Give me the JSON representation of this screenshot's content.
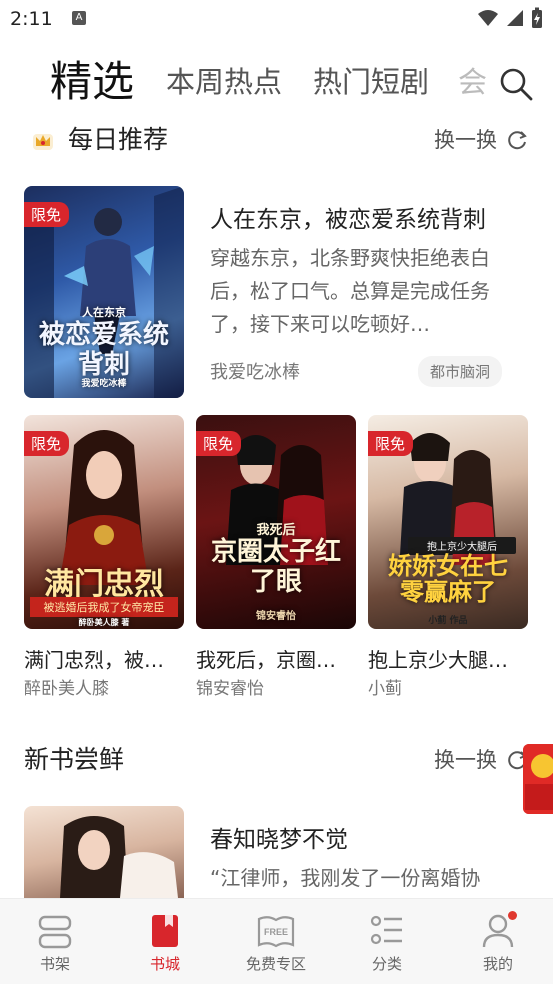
{
  "status": {
    "time": "2:11",
    "notif_glyph": "A"
  },
  "tabs": [
    {
      "label": "精选",
      "active": true
    },
    {
      "label": "本周热点",
      "active": false
    },
    {
      "label": "热门短剧",
      "active": false
    },
    {
      "label": "会",
      "active": false
    }
  ],
  "daily": {
    "title": "每日推荐",
    "refresh_label": "换一换",
    "featured": {
      "badge": "限免",
      "cover_text_small": "人在东京",
      "cover_text": "被恋爱系统背刺",
      "cover_author": "我爱吃冰棒",
      "title": "人在东京，被恋爱系统背刺",
      "desc": "穿越东京，北条野爽快拒绝表白后，松了口气。总算是完成任务了，接下来可以吃顿好…",
      "author": "我爱吃冰棒",
      "tag": "都市脑洞"
    },
    "grid": [
      {
        "badge": "限免",
        "cover_text": "满门忠烈",
        "cover_sub": "被逃婚后我成了女帝宠臣",
        "cover_author": "醉卧美人膝 著",
        "title": "满门忠烈，被…",
        "author": "醉卧美人膝"
      },
      {
        "badge": "限免",
        "cover_text_small": "我死后",
        "cover_text": "京圈太子红了眼",
        "cover_author": "锦安睿怡",
        "title": "我死后，京圈…",
        "author": "锦安睿怡"
      },
      {
        "badge": "限免",
        "cover_text_small": "抱上京少大腿后",
        "cover_text": "娇娇女在七零赢麻了",
        "cover_author": "小蓟 作品",
        "title": "抱上京少大腿…",
        "author": "小蓟"
      }
    ]
  },
  "new_books": {
    "title": "新书尝鲜",
    "refresh_label": "换一换",
    "item": {
      "title": "春知晓梦不觉",
      "desc": "“江律师，我刚发了一份离婚协"
    }
  },
  "nav": [
    {
      "label": "书架",
      "icon": "bookshelf-icon",
      "active": false
    },
    {
      "label": "书城",
      "icon": "bookstore-icon",
      "active": true
    },
    {
      "label": "免费专区",
      "icon": "free-book-icon",
      "active": false,
      "icon_text": "FREE"
    },
    {
      "label": "分类",
      "icon": "category-icon",
      "active": false
    },
    {
      "label": "我的",
      "icon": "profile-icon",
      "active": false
    }
  ],
  "colors": {
    "accent": "#d8262c",
    "text": "#222222",
    "muted": "#777777"
  }
}
